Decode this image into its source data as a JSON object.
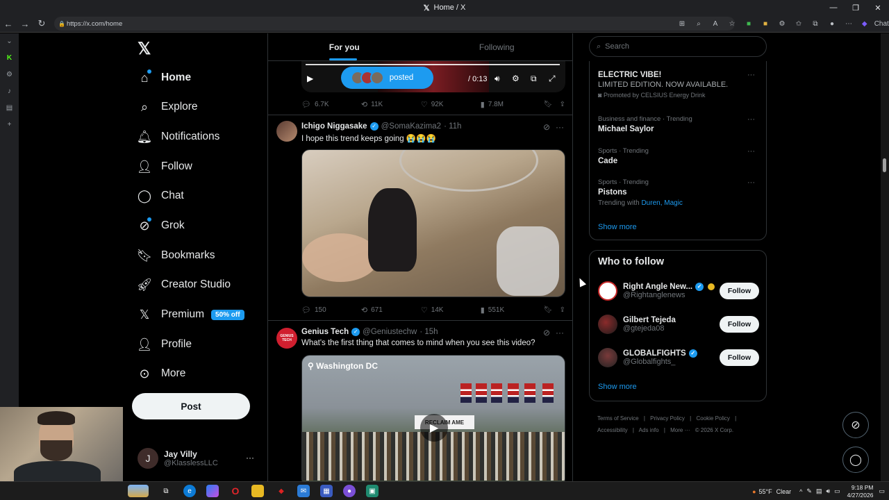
{
  "browser": {
    "title": "Home / X",
    "url": "https://x.com/home",
    "chat_label": "Chat"
  },
  "nav": {
    "items": [
      {
        "label": "Home",
        "icon": "home-icon"
      },
      {
        "label": "Explore",
        "icon": "search-icon"
      },
      {
        "label": "Notifications",
        "icon": "bell-icon"
      },
      {
        "label": "Follow",
        "icon": "person-plus-icon"
      },
      {
        "label": "Chat",
        "icon": "chat-bubble-icon"
      },
      {
        "label": "Grok",
        "icon": "grok-icon"
      },
      {
        "label": "Bookmarks",
        "icon": "bookmark-icon"
      },
      {
        "label": "Creator Studio",
        "icon": "rocket-icon"
      },
      {
        "label": "Premium",
        "icon": "x-icon"
      },
      {
        "label": "Profile",
        "icon": "person-icon"
      },
      {
        "label": "More",
        "icon": "more-circle-icon"
      }
    ],
    "premium_badge": "50% off",
    "post_label": "Post",
    "account": {
      "initial": "J",
      "name": "Jay Villy",
      "handle": "@KlasslessLLC"
    }
  },
  "timeline": {
    "tabs": [
      {
        "label": "For you",
        "active": true
      },
      {
        "label": "Following",
        "active": false
      }
    ],
    "tweet1": {
      "video_pill_label": "posted",
      "video_time": "/ 0:13",
      "replies": "6.7K",
      "reposts": "11K",
      "likes": "92K",
      "views": "7.8M"
    },
    "tweet2": {
      "name": "Ichigo Niggasake",
      "handle": "@SomaKazima2",
      "time": "· 11h",
      "text": "I hope this trend keeps going 😭😭😭",
      "replies": "150",
      "reposts": "671",
      "likes": "14K",
      "views": "551K"
    },
    "tweet3": {
      "name": "Genius Tech",
      "avatar_text": "GENIUS TECH",
      "handle": "@Geniustechw",
      "time": "· 15h",
      "text": "What's the first thing that comes to mind when you see this video?",
      "location": "Washington DC",
      "banner_text": "RECLAIM AME"
    }
  },
  "sidebar": {
    "search_placeholder": "Search",
    "trends": [
      {
        "category": "",
        "title": "ELECTRIC VIBE!",
        "subtitle": "LIMITED EDITION. NOW AVAILABLE.",
        "promoted": "Promoted by CELSIUS Energy Drink"
      },
      {
        "category": "Business and finance · Trending",
        "title": "Michael Saylor"
      },
      {
        "category": "Sports · Trending",
        "title": "Cade"
      },
      {
        "category": "Sports · Trending",
        "title": "Pistons",
        "trending_with_label": "Trending with",
        "trending_with": "Duren, Magic"
      }
    ],
    "show_more": "Show more",
    "who_to_follow": {
      "title": "Who to follow",
      "users": [
        {
          "name": "Right Angle New...",
          "handle": "@Rightanglenews",
          "button": "Follow"
        },
        {
          "name": "Gilbert Tejeda",
          "handle": "@gtejeda08",
          "button": "Follow"
        },
        {
          "name": "GLOBALFIGHTS",
          "handle": "@Globalfights_",
          "button": "Follow"
        }
      ],
      "show_more": "Show more"
    },
    "footer": [
      "Terms of Service",
      "|",
      "Privacy Policy",
      "|",
      "Cookie Policy",
      "|",
      "Accessibility",
      "|",
      "Ads info",
      "|",
      "More ···",
      "© 2026 X Corp."
    ]
  },
  "taskbar": {
    "weather": "55°F",
    "weather_desc": "Clear",
    "time": "9:18 PM",
    "date": "4/27/2026"
  },
  "colors": {
    "accent": "#1d9bf0",
    "background": "#000000",
    "text": "#e7e9ea",
    "muted": "#71767b",
    "border": "#2f3336"
  }
}
